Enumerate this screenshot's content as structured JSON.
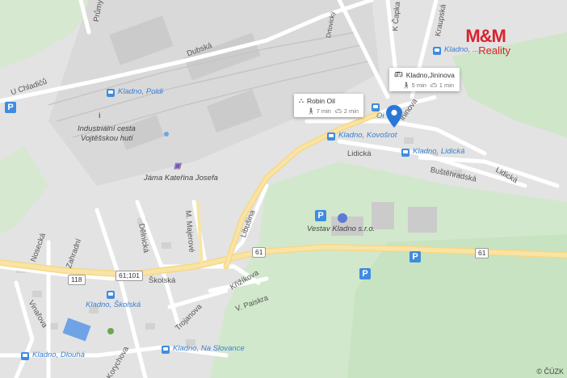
{
  "logo": {
    "brand": "M&M",
    "sub": "Reality"
  },
  "copyright": "© ČÚZK",
  "colors": {
    "road": "#ffffff",
    "highway": "#f5d77e",
    "forest": "#cfe8c9",
    "urban": "#dcdcdc",
    "marker": "#2a78d6",
    "poi": "#3f8ce0"
  },
  "streets": {
    "prumyslova": "Průmyslová",
    "dubska": "Dubská",
    "u_chladicu": "U Chladičů",
    "dretovicky": "Drtovický",
    "k_capka": "K Čapka",
    "krausova": "Kraupská",
    "jininova": "Jininova",
    "lidicka1": "Lidická",
    "lidicka2": "Lidická",
    "bustehradska": "Buštěhradská",
    "majerove": "M. Majerové",
    "dakicka": "Dělnická",
    "zahradni": "Zahradní",
    "nosecka": "Nosecká",
    "skolska": "Školská",
    "krizikova": "Křižíkova",
    "paiskra": "V. Paiskra",
    "trojanova": "Trojanova",
    "vinarova": "Vinařova",
    "libusina": "Libušina",
    "korychova": "Korychova"
  },
  "places": {
    "kladno_poldi": "Kladno, Poldi",
    "industrial": "Industriální cesta",
    "industrial2": "Vojtěšskou hutí",
    "jama": "Jáma Kateřina Josefa",
    "kovosrot": "Kladno, Kovošrot",
    "lidicka_stop": "Kladno, Lidická",
    "vestav": "Vestav Kladno s.r.o.",
    "skolska_stop": "Kladno, Školská",
    "na_slovance": "Kladno, Na Slovance",
    "dlouha": "Kladno, Dlouhá",
    "top_stop": "Kladno, ..."
  },
  "roads": {
    "r61a": "61",
    "r61b": "61",
    "r61c": "61",
    "r118": "118",
    "r61_101": "61;101"
  },
  "popups": {
    "robin": {
      "title": "Robin Oil",
      "walk": "7 min",
      "drive": "2 min"
    },
    "jininova": {
      "title": "Kladno,Jininova",
      "walk": "5 min",
      "drive": "1 min"
    }
  },
  "partial_labels": {
    "oil": "Oi",
    "jininova_road": "ininova"
  }
}
